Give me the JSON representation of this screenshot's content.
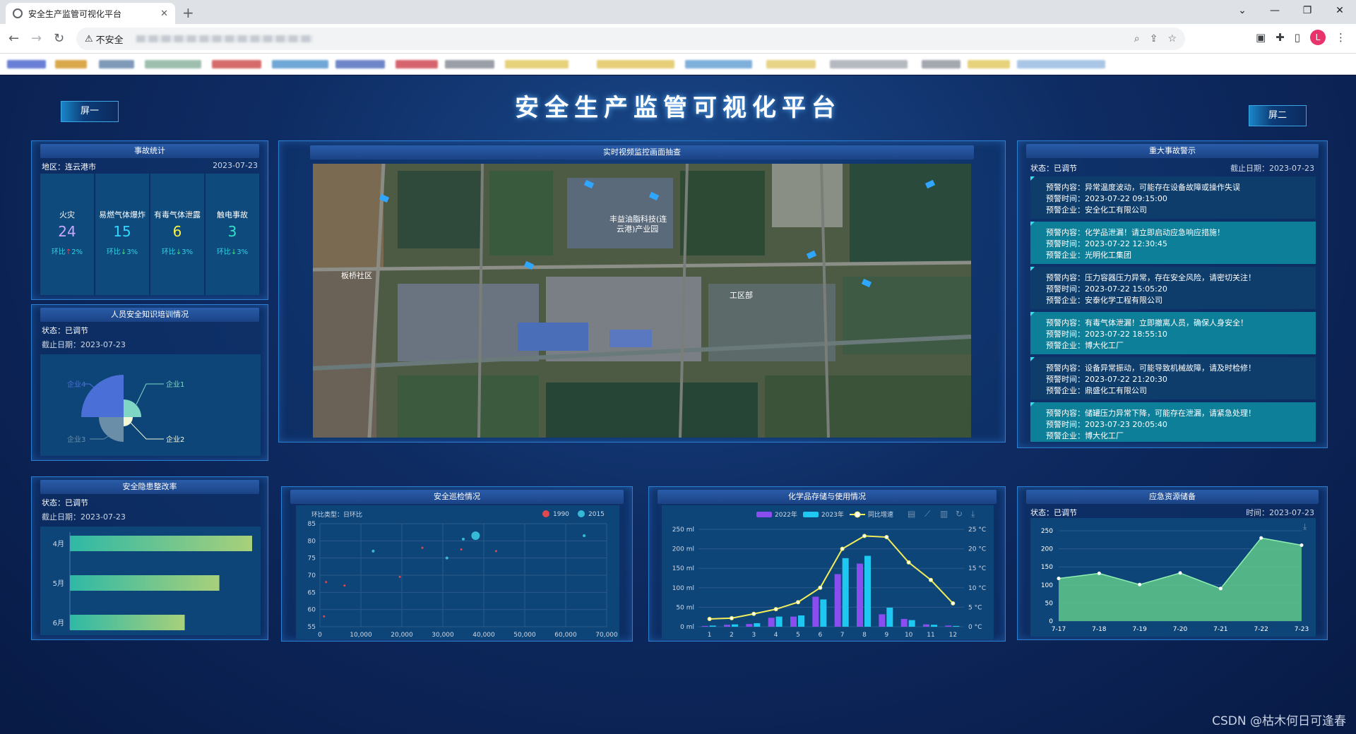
{
  "browser": {
    "tab_title": "安全生产监管可视化平台",
    "tab_close": "✕",
    "new_tab": "+",
    "security_label": "不安全",
    "avatar_letter": "L"
  },
  "header": {
    "title": "安全生产监管可视化平台",
    "screen1_label": "屏一",
    "screen2_label": "屏二"
  },
  "accident": {
    "title": "事故统计",
    "region": "地区：连云港市",
    "date": "2023-07-23",
    "items": [
      {
        "name": "火灾",
        "value": "24",
        "ratio": "环比",
        "dir": "↑",
        "pct": "2%",
        "color": "#c9a7ff",
        "dircolor": "#ff3b3b"
      },
      {
        "name": "易燃气体爆炸",
        "value": "15",
        "ratio": "环比",
        "dir": "↓",
        "pct": "3%",
        "color": "#33d6ff",
        "dircolor": "#3ee86c"
      },
      {
        "name": "有毒气体泄露",
        "value": "6",
        "ratio": "环比",
        "dir": "↓",
        "pct": "3%",
        "color": "#f7f04b",
        "dircolor": "#3ee86c"
      },
      {
        "name": "触电事故",
        "value": "3",
        "ratio": "环比",
        "dir": "↓",
        "pct": "3%",
        "color": "#33e2c8",
        "dircolor": "#3ee86c"
      }
    ]
  },
  "training": {
    "title": "人员安全知识培训情况",
    "status": "状态：已调节",
    "date": "截止日期：2023-07-23",
    "labels": [
      "企业1",
      "企业2",
      "企业3",
      "企业4"
    ],
    "colors": [
      "#7fd6c4",
      "#f2f7d6",
      "#6b8ea8",
      "#4a70d8"
    ]
  },
  "hazard": {
    "title": "安全隐患整改率",
    "status": "状态：已调节",
    "date": "截止日期：2023-07-23"
  },
  "video": {
    "title": "实时视频监控画面抽查",
    "map_labels": [
      "丰益油脂科技(连",
      "云港)产业园",
      "板桥社区",
      "工区部"
    ]
  },
  "warnings": {
    "title": "重大事故警示",
    "status": "状态：已调节",
    "date": "截止日期：2023-07-23",
    "items": [
      {
        "content": "预警内容：异常温度波动，可能存在设备故障或操作失误",
        "time": "预警时间：2023-07-22 09:15:00",
        "company": "预警企业：安全化工有限公司"
      },
      {
        "content": "预警内容：化学品泄漏！请立即启动应急响应措施！",
        "time": "预警时间：2023-07-22 12:30:45",
        "company": "预警企业：光明化工集团"
      },
      {
        "content": "预警内容：压力容器压力异常，存在安全风险，请密切关注！",
        "time": "预警时间：2023-07-22 15:05:20",
        "company": "预警企业：安泰化学工程有限公司"
      },
      {
        "content": "预警内容：有毒气体泄漏！立即撤离人员，确保人身安全！",
        "time": "预警时间：2023-07-22 18:55:10",
        "company": "预警企业：博大化工厂"
      },
      {
        "content": "预警内容：设备异常振动，可能导致机械故障，请及时检修！",
        "time": "预警时间：2023-07-22 21:20:30",
        "company": "预警企业：鼎盛化工有限公司"
      },
      {
        "content": "预警内容：储罐压力异常下降，可能存在泄漏，请紧急处理！",
        "time": "预警时间：2023-07-23 20:05:40",
        "company": "预警企业：博大化工厂"
      }
    ]
  },
  "patrol": {
    "title": "安全巡检情况",
    "subtitle": "环比类型：日环比",
    "legend": [
      "1990",
      "2015"
    ]
  },
  "chemical": {
    "title": "化学品存储与使用情况",
    "legend": [
      "2022年",
      "2023年",
      "同比增速"
    ]
  },
  "emergency": {
    "title": "应急资源储备",
    "status": "状态：已调节",
    "time": "时间：2023-07-23"
  },
  "watermark": "CSDN @枯木何日可逢春",
  "chart_data": [
    {
      "type": "pie",
      "title": "人员安全知识培训情况",
      "categories": [
        "企业1",
        "企业2",
        "企业3",
        "企业4"
      ],
      "values": [
        20,
        5,
        25,
        50
      ]
    },
    {
      "type": "bar",
      "title": "安全隐患整改率",
      "categories": [
        "4月",
        "5月",
        "6月"
      ],
      "values": [
        100,
        82,
        63
      ],
      "xlim": [
        0,
        100
      ]
    },
    {
      "type": "scatter",
      "title": "安全巡检情况",
      "x_ticks": [
        "0",
        "10,000",
        "20,000",
        "30,000",
        "40,000",
        "50,000",
        "60,000",
        "70,000"
      ],
      "y_ticks": [
        "55",
        "60",
        "65",
        "70",
        "75",
        "80",
        "85"
      ],
      "xlim": [
        0,
        70000
      ],
      "ylim": [
        55,
        85
      ],
      "series": [
        {
          "name": "1990",
          "color": "#e0484f",
          "points": [
            [
              1500,
              68
            ],
            [
              6000,
              67
            ],
            [
              19500,
              69.5
            ],
            [
              25000,
              78
            ],
            [
              43000,
              77
            ],
            [
              1000,
              58
            ],
            [
              34500,
              77.5
            ]
          ]
        },
        {
          "name": "2015",
          "color": "#36b9d6",
          "points": [
            [
              38000,
              81.5
            ],
            [
              35000,
              80.5
            ],
            [
              64500,
              81.5
            ],
            [
              13000,
              77
            ],
            [
              31000,
              75
            ]
          ]
        }
      ]
    },
    {
      "type": "bar",
      "title": "化学品存储与使用情况",
      "categories": [
        "1",
        "2",
        "3",
        "4",
        "5",
        "6",
        "7",
        "8",
        "9",
        "10",
        "11",
        "12"
      ],
      "y_ticks_left": [
        "0 ml",
        "50 ml",
        "100 ml",
        "150 ml",
        "200 ml",
        "250 ml"
      ],
      "y_ticks_right": [
        "0 °C",
        "5 °C",
        "10 °C",
        "15 °C",
        "20 °C",
        "25 °C"
      ],
      "ylim": [
        0,
        250
      ],
      "ylim_right": [
        0,
        25
      ],
      "series": [
        {
          "name": "2022年",
          "type": "bar",
          "color": "#8a4df0",
          "values": [
            2,
            5,
            7,
            23,
            26,
            77,
            135,
            162,
            32,
            20,
            6,
            3
          ]
        },
        {
          "name": "2023年",
          "type": "bar",
          "color": "#1ec8f0",
          "values": [
            3,
            6,
            9,
            26,
            29,
            70,
            176,
            182,
            49,
            17,
            5,
            2
          ]
        },
        {
          "name": "同比增速",
          "type": "line",
          "color": "#f2ec5a",
          "values": [
            2,
            2.2,
            3.3,
            4.5,
            6.3,
            10,
            20,
            23.3,
            23,
            16.5,
            12,
            6
          ]
        }
      ]
    },
    {
      "type": "area",
      "title": "应急资源储备",
      "categories": [
        "7-17",
        "7-18",
        "7-19",
        "7-20",
        "7-21",
        "7-22",
        "7-23"
      ],
      "y_ticks": [
        "0",
        "50",
        "100",
        "150",
        "200",
        "250"
      ],
      "ylim": [
        0,
        250
      ],
      "values": [
        118,
        132,
        101,
        133,
        90,
        230,
        210
      ]
    }
  ]
}
